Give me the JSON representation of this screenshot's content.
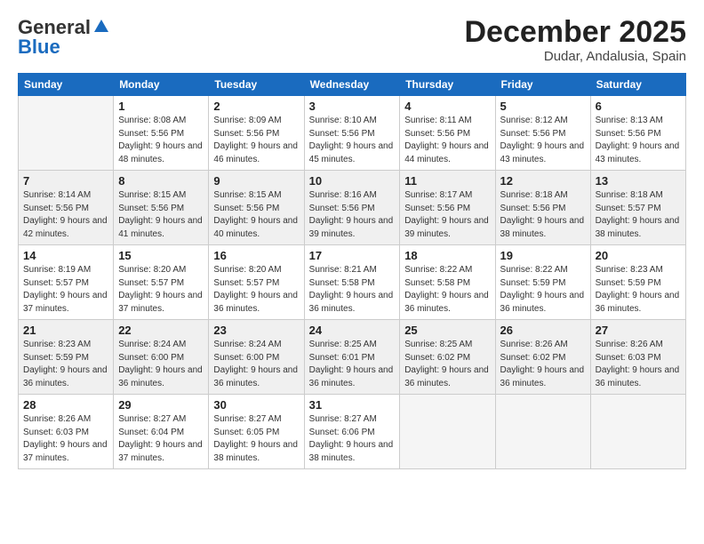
{
  "header": {
    "logo_line1": "General",
    "logo_line2": "Blue",
    "month_title": "December 2025",
    "location": "Dudar, Andalusia, Spain"
  },
  "weekdays": [
    "Sunday",
    "Monday",
    "Tuesday",
    "Wednesday",
    "Thursday",
    "Friday",
    "Saturday"
  ],
  "weeks": [
    [
      {
        "day": "",
        "sunrise": "",
        "sunset": "",
        "daylight": ""
      },
      {
        "day": "1",
        "sunrise": "Sunrise: 8:08 AM",
        "sunset": "Sunset: 5:56 PM",
        "daylight": "Daylight: 9 hours and 48 minutes."
      },
      {
        "day": "2",
        "sunrise": "Sunrise: 8:09 AM",
        "sunset": "Sunset: 5:56 PM",
        "daylight": "Daylight: 9 hours and 46 minutes."
      },
      {
        "day": "3",
        "sunrise": "Sunrise: 8:10 AM",
        "sunset": "Sunset: 5:56 PM",
        "daylight": "Daylight: 9 hours and 45 minutes."
      },
      {
        "day": "4",
        "sunrise": "Sunrise: 8:11 AM",
        "sunset": "Sunset: 5:56 PM",
        "daylight": "Daylight: 9 hours and 44 minutes."
      },
      {
        "day": "5",
        "sunrise": "Sunrise: 8:12 AM",
        "sunset": "Sunset: 5:56 PM",
        "daylight": "Daylight: 9 hours and 43 minutes."
      },
      {
        "day": "6",
        "sunrise": "Sunrise: 8:13 AM",
        "sunset": "Sunset: 5:56 PM",
        "daylight": "Daylight: 9 hours and 43 minutes."
      }
    ],
    [
      {
        "day": "7",
        "sunrise": "Sunrise: 8:14 AM",
        "sunset": "Sunset: 5:56 PM",
        "daylight": "Daylight: 9 hours and 42 minutes."
      },
      {
        "day": "8",
        "sunrise": "Sunrise: 8:15 AM",
        "sunset": "Sunset: 5:56 PM",
        "daylight": "Daylight: 9 hours and 41 minutes."
      },
      {
        "day": "9",
        "sunrise": "Sunrise: 8:15 AM",
        "sunset": "Sunset: 5:56 PM",
        "daylight": "Daylight: 9 hours and 40 minutes."
      },
      {
        "day": "10",
        "sunrise": "Sunrise: 8:16 AM",
        "sunset": "Sunset: 5:56 PM",
        "daylight": "Daylight: 9 hours and 39 minutes."
      },
      {
        "day": "11",
        "sunrise": "Sunrise: 8:17 AM",
        "sunset": "Sunset: 5:56 PM",
        "daylight": "Daylight: 9 hours and 39 minutes."
      },
      {
        "day": "12",
        "sunrise": "Sunrise: 8:18 AM",
        "sunset": "Sunset: 5:56 PM",
        "daylight": "Daylight: 9 hours and 38 minutes."
      },
      {
        "day": "13",
        "sunrise": "Sunrise: 8:18 AM",
        "sunset": "Sunset: 5:57 PM",
        "daylight": "Daylight: 9 hours and 38 minutes."
      }
    ],
    [
      {
        "day": "14",
        "sunrise": "Sunrise: 8:19 AM",
        "sunset": "Sunset: 5:57 PM",
        "daylight": "Daylight: 9 hours and 37 minutes."
      },
      {
        "day": "15",
        "sunrise": "Sunrise: 8:20 AM",
        "sunset": "Sunset: 5:57 PM",
        "daylight": "Daylight: 9 hours and 37 minutes."
      },
      {
        "day": "16",
        "sunrise": "Sunrise: 8:20 AM",
        "sunset": "Sunset: 5:57 PM",
        "daylight": "Daylight: 9 hours and 36 minutes."
      },
      {
        "day": "17",
        "sunrise": "Sunrise: 8:21 AM",
        "sunset": "Sunset: 5:58 PM",
        "daylight": "Daylight: 9 hours and 36 minutes."
      },
      {
        "day": "18",
        "sunrise": "Sunrise: 8:22 AM",
        "sunset": "Sunset: 5:58 PM",
        "daylight": "Daylight: 9 hours and 36 minutes."
      },
      {
        "day": "19",
        "sunrise": "Sunrise: 8:22 AM",
        "sunset": "Sunset: 5:59 PM",
        "daylight": "Daylight: 9 hours and 36 minutes."
      },
      {
        "day": "20",
        "sunrise": "Sunrise: 8:23 AM",
        "sunset": "Sunset: 5:59 PM",
        "daylight": "Daylight: 9 hours and 36 minutes."
      }
    ],
    [
      {
        "day": "21",
        "sunrise": "Sunrise: 8:23 AM",
        "sunset": "Sunset: 5:59 PM",
        "daylight": "Daylight: 9 hours and 36 minutes."
      },
      {
        "day": "22",
        "sunrise": "Sunrise: 8:24 AM",
        "sunset": "Sunset: 6:00 PM",
        "daylight": "Daylight: 9 hours and 36 minutes."
      },
      {
        "day": "23",
        "sunrise": "Sunrise: 8:24 AM",
        "sunset": "Sunset: 6:00 PM",
        "daylight": "Daylight: 9 hours and 36 minutes."
      },
      {
        "day": "24",
        "sunrise": "Sunrise: 8:25 AM",
        "sunset": "Sunset: 6:01 PM",
        "daylight": "Daylight: 9 hours and 36 minutes."
      },
      {
        "day": "25",
        "sunrise": "Sunrise: 8:25 AM",
        "sunset": "Sunset: 6:02 PM",
        "daylight": "Daylight: 9 hours and 36 minutes."
      },
      {
        "day": "26",
        "sunrise": "Sunrise: 8:26 AM",
        "sunset": "Sunset: 6:02 PM",
        "daylight": "Daylight: 9 hours and 36 minutes."
      },
      {
        "day": "27",
        "sunrise": "Sunrise: 8:26 AM",
        "sunset": "Sunset: 6:03 PM",
        "daylight": "Daylight: 9 hours and 36 minutes."
      }
    ],
    [
      {
        "day": "28",
        "sunrise": "Sunrise: 8:26 AM",
        "sunset": "Sunset: 6:03 PM",
        "daylight": "Daylight: 9 hours and 37 minutes."
      },
      {
        "day": "29",
        "sunrise": "Sunrise: 8:27 AM",
        "sunset": "Sunset: 6:04 PM",
        "daylight": "Daylight: 9 hours and 37 minutes."
      },
      {
        "day": "30",
        "sunrise": "Sunrise: 8:27 AM",
        "sunset": "Sunset: 6:05 PM",
        "daylight": "Daylight: 9 hours and 38 minutes."
      },
      {
        "day": "31",
        "sunrise": "Sunrise: 8:27 AM",
        "sunset": "Sunset: 6:06 PM",
        "daylight": "Daylight: 9 hours and 38 minutes."
      },
      {
        "day": "",
        "sunrise": "",
        "sunset": "",
        "daylight": ""
      },
      {
        "day": "",
        "sunrise": "",
        "sunset": "",
        "daylight": ""
      },
      {
        "day": "",
        "sunrise": "",
        "sunset": "",
        "daylight": ""
      }
    ]
  ]
}
